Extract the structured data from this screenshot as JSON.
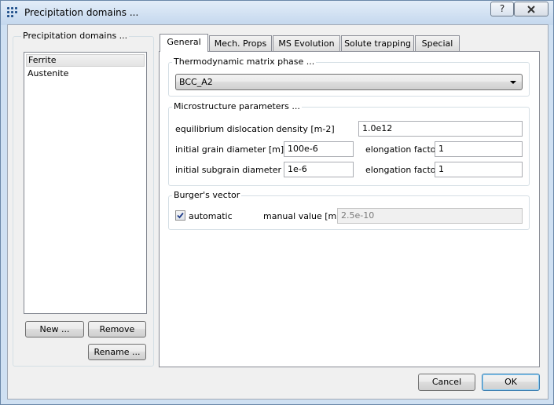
{
  "window": {
    "title": "Precipitation domains ...",
    "help_icon": "?",
    "close_icon": "X"
  },
  "left_panel": {
    "group_title": "Precipitation domains ...",
    "domains": [
      "Ferrite",
      "Austenite"
    ],
    "selected_domain": "Ferrite",
    "new_button": "New ...",
    "remove_button": "Remove",
    "rename_button": "Rename ..."
  },
  "tabs": [
    "General",
    "Mech. Props",
    "MS Evolution",
    "Solute trapping",
    "Special"
  ],
  "active_tab": "General",
  "general": {
    "thermo_group_title": "Thermodynamic matrix phase ...",
    "matrix_phase": "BCC_A2",
    "micro_group_title": "Microstructure parameters ...",
    "dislocation_density_label": "equilibrium dislocation density  [m-2]",
    "dislocation_density_value": "1.0e12",
    "grain_diameter_label": "initial grain diameter [m]",
    "grain_diameter_value": "100e-6",
    "grain_elongation_label": "elongation factor",
    "grain_elongation_value": "1",
    "subgrain_diameter_label": "initial subgrain diameter [m]",
    "subgrain_diameter_value": "1e-6",
    "subgrain_elongation_label": "elongation factor",
    "subgrain_elongation_value": "1",
    "burgers_group_title": "Burger's vector",
    "automatic_label": "automatic",
    "automatic_checked": true,
    "manual_value_label": "manual value [m]",
    "manual_value": "2.5e-10"
  },
  "footer": {
    "cancel_button": "Cancel",
    "ok_button": "OK"
  }
}
